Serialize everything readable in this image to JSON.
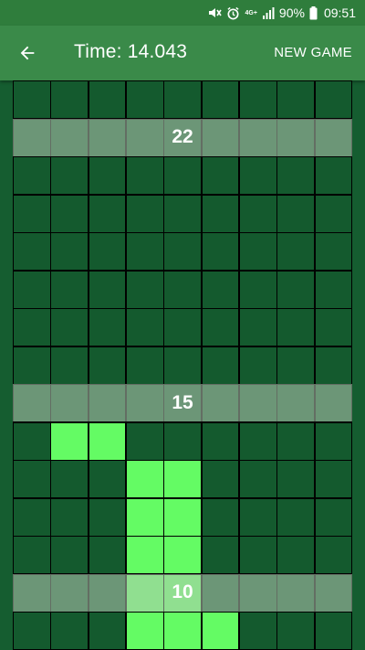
{
  "status_bar": {
    "icons": [
      "mute-icon",
      "alarm-icon",
      "4g-icon",
      "signal-icon"
    ],
    "network": "4G+",
    "battery": "90%",
    "time": "09:51"
  },
  "app_bar": {
    "back_icon": "arrow-left-icon",
    "title": "Time: 14.043",
    "new_game_label": "NEW GAME"
  },
  "board": {
    "columns": 9,
    "visible_rows": 15,
    "colors": {
      "cell": "#145a2e",
      "lit": "#64fb64",
      "grid_line": "#000000",
      "marker_band": "#8fb695"
    },
    "lit_cells": [
      [
        9,
        1
      ],
      [
        9,
        2
      ],
      [
        10,
        3
      ],
      [
        10,
        4
      ],
      [
        11,
        3
      ],
      [
        11,
        4
      ],
      [
        12,
        3
      ],
      [
        12,
        4
      ],
      [
        13,
        3
      ],
      [
        13,
        4
      ],
      [
        14,
        3
      ],
      [
        14,
        4
      ],
      [
        14,
        5
      ]
    ],
    "markers": [
      {
        "row": 1,
        "label": "22"
      },
      {
        "row": 8,
        "label": "15"
      },
      {
        "row": 13,
        "label": "10"
      }
    ]
  }
}
